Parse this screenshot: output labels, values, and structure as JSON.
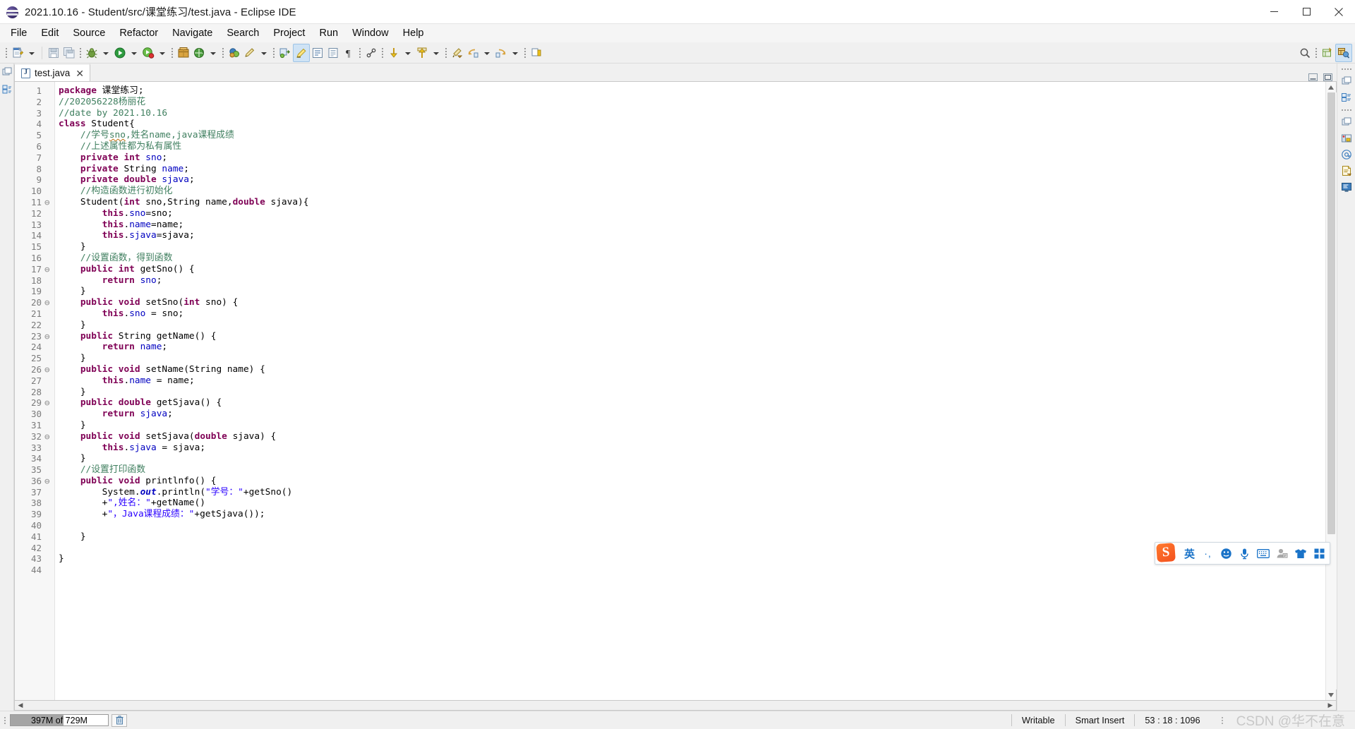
{
  "window": {
    "title": "2021.10.16 - Student/src/课堂练习/test.java - Eclipse IDE",
    "app_icon": "eclipse-sphere-icon",
    "minimize": "—",
    "maximize": "▢",
    "close": "✕"
  },
  "menubar": {
    "items": [
      {
        "label": "File"
      },
      {
        "label": "Edit"
      },
      {
        "label": "Source"
      },
      {
        "label": "Refactor"
      },
      {
        "label": "Navigate"
      },
      {
        "label": "Search"
      },
      {
        "label": "Project"
      },
      {
        "label": "Run"
      },
      {
        "label": "Window"
      },
      {
        "label": "Help"
      }
    ]
  },
  "toolbar": {
    "groups": [
      {
        "items": [
          {
            "name": "new-wizard",
            "icon": "new-file-icon",
            "dropdown": true
          }
        ]
      },
      {
        "items": [
          {
            "name": "save",
            "icon": "save-icon",
            "dropdown": false
          },
          {
            "name": "save-all",
            "icon": "save-all-icon",
            "dropdown": false
          }
        ]
      },
      {
        "items": [
          {
            "name": "debug",
            "icon": "debug-bug-icon",
            "dropdown": true
          },
          {
            "name": "run",
            "icon": "run-play-icon",
            "dropdown": true
          },
          {
            "name": "coverage",
            "icon": "coverage-icon",
            "dropdown": true
          }
        ]
      },
      {
        "items": [
          {
            "name": "new-java-package",
            "icon": "package-icon",
            "dropdown": false
          },
          {
            "name": "external-tools",
            "icon": "external-tools-icon",
            "dropdown": true
          }
        ]
      },
      {
        "items": [
          {
            "name": "new-java-class",
            "icon": "java-class-icon",
            "dropdown": false
          },
          {
            "name": "open-task",
            "icon": "pencil-icon",
            "dropdown": true
          }
        ]
      },
      {
        "items": [
          {
            "name": "search-refactor",
            "icon": "refactor-icon",
            "dropdown": false
          },
          {
            "name": "toggle-mark-occurrences",
            "icon": "marker-highlight-icon",
            "active": true
          },
          {
            "name": "show-whitespace",
            "icon": "whitespace-icon",
            "dropdown": false
          },
          {
            "name": "block-selection",
            "icon": "block-select-icon",
            "dropdown": false
          },
          {
            "name": "show-pilcrow",
            "icon": "pilcrow-icon",
            "dropdown": false
          }
        ]
      },
      {
        "items": [
          {
            "name": "link-editor",
            "icon": "link-icon",
            "dropdown": false
          }
        ]
      },
      {
        "items": [
          {
            "name": "previous-annotation",
            "icon": "arrow-down-yellow-icon",
            "dropdown": true
          },
          {
            "name": "next-annotation",
            "icon": "arrow-up-yellow-icon",
            "dropdown": true
          }
        ]
      },
      {
        "items": [
          {
            "name": "back",
            "icon": "back-arrow-icon",
            "dropdown": false
          },
          {
            "name": "forward",
            "icon": "forward-arrow-icon",
            "dropdown": false
          }
        ]
      },
      {
        "items": [
          {
            "name": "last-edit-location",
            "icon": "last-edit-icon",
            "dropdown": false
          },
          {
            "name": "back-history",
            "icon": "history-back-icon",
            "dropdown": true
          },
          {
            "name": "forward-history",
            "icon": "history-forward-icon",
            "dropdown": true
          }
        ]
      },
      {
        "items": [
          {
            "name": "pin-editor",
            "icon": "pin-icon",
            "dropdown": false
          }
        ]
      }
    ],
    "right": [
      {
        "name": "quick-access-search",
        "icon": "search-icon"
      },
      {
        "name": "open-perspective",
        "icon": "open-perspective-icon"
      },
      {
        "name": "java-perspective",
        "icon": "java-perspective-icon",
        "active": true
      }
    ]
  },
  "editor": {
    "tab": {
      "label": "test.java",
      "icon": "java-file-icon",
      "close": "✕",
      "active": true
    },
    "tab_controls": {
      "minimize": "minimize-icon",
      "maximize": "maximize-icon"
    },
    "lines": [
      {
        "n": 1,
        "fold": "",
        "tokens": [
          {
            "t": "package",
            "c": "kw"
          },
          {
            "t": " 课堂练习;",
            "c": "pl"
          }
        ]
      },
      {
        "n": 2,
        "fold": "",
        "tokens": [
          {
            "t": "//202056228杨丽花",
            "c": "cmt"
          }
        ]
      },
      {
        "n": 3,
        "fold": "",
        "tokens": [
          {
            "t": "//date by 2021.10.16",
            "c": "cmt"
          }
        ]
      },
      {
        "n": 4,
        "fold": "",
        "tokens": [
          {
            "t": "class",
            "c": "kw"
          },
          {
            "t": " Student{",
            "c": "pl"
          }
        ]
      },
      {
        "n": 5,
        "fold": "",
        "tokens": [
          {
            "t": "    //学号",
            "c": "cmt"
          },
          {
            "t": "sno",
            "c": "cmt sq"
          },
          {
            "t": ",姓名name,java课程成绩",
            "c": "cmt"
          }
        ]
      },
      {
        "n": 6,
        "fold": "",
        "tokens": [
          {
            "t": "    //上述属性都为私有属性",
            "c": "cmt"
          }
        ]
      },
      {
        "n": 7,
        "fold": "",
        "tokens": [
          {
            "t": "    ",
            "c": "pl"
          },
          {
            "t": "private int",
            "c": "kw"
          },
          {
            "t": " ",
            "c": "pl"
          },
          {
            "t": "sno",
            "c": "fld"
          },
          {
            "t": ";",
            "c": "pl"
          }
        ]
      },
      {
        "n": 8,
        "fold": "",
        "tokens": [
          {
            "t": "    ",
            "c": "pl"
          },
          {
            "t": "private",
            "c": "kw"
          },
          {
            "t": " String ",
            "c": "pl"
          },
          {
            "t": "name",
            "c": "fld"
          },
          {
            "t": ";",
            "c": "pl"
          }
        ]
      },
      {
        "n": 9,
        "fold": "",
        "tokens": [
          {
            "t": "    ",
            "c": "pl"
          },
          {
            "t": "private double",
            "c": "kw"
          },
          {
            "t": " ",
            "c": "pl"
          },
          {
            "t": "sjava",
            "c": "fld"
          },
          {
            "t": ";",
            "c": "pl"
          }
        ]
      },
      {
        "n": 10,
        "fold": "",
        "tokens": [
          {
            "t": "    //构造函数进行初始化",
            "c": "cmt"
          }
        ]
      },
      {
        "n": 11,
        "fold": "⊖",
        "tokens": [
          {
            "t": "    Student(",
            "c": "pl"
          },
          {
            "t": "int",
            "c": "kw"
          },
          {
            "t": " sno,String name,",
            "c": "pl"
          },
          {
            "t": "double",
            "c": "kw"
          },
          {
            "t": " sjava){",
            "c": "pl"
          }
        ]
      },
      {
        "n": 12,
        "fold": "",
        "tokens": [
          {
            "t": "        ",
            "c": "pl"
          },
          {
            "t": "this",
            "c": "kw"
          },
          {
            "t": ".",
            "c": "pl"
          },
          {
            "t": "sno",
            "c": "fld"
          },
          {
            "t": "=sno;",
            "c": "pl"
          }
        ]
      },
      {
        "n": 13,
        "fold": "",
        "tokens": [
          {
            "t": "        ",
            "c": "pl"
          },
          {
            "t": "this",
            "c": "kw"
          },
          {
            "t": ".",
            "c": "pl"
          },
          {
            "t": "name",
            "c": "fld"
          },
          {
            "t": "=name;",
            "c": "pl"
          }
        ]
      },
      {
        "n": 14,
        "fold": "",
        "tokens": [
          {
            "t": "        ",
            "c": "pl"
          },
          {
            "t": "this",
            "c": "kw"
          },
          {
            "t": ".",
            "c": "pl"
          },
          {
            "t": "sjava",
            "c": "fld"
          },
          {
            "t": "=sjava;",
            "c": "pl"
          }
        ]
      },
      {
        "n": 15,
        "fold": "",
        "tokens": [
          {
            "t": "    }",
            "c": "pl"
          }
        ]
      },
      {
        "n": 16,
        "fold": "",
        "tokens": [
          {
            "t": "    //设置函数，得到函数",
            "c": "cmt"
          }
        ]
      },
      {
        "n": 17,
        "fold": "⊖",
        "tokens": [
          {
            "t": "    ",
            "c": "pl"
          },
          {
            "t": "public int",
            "c": "kw"
          },
          {
            "t": " getSno() {",
            "c": "pl"
          }
        ]
      },
      {
        "n": 18,
        "fold": "",
        "tokens": [
          {
            "t": "        ",
            "c": "pl"
          },
          {
            "t": "return",
            "c": "kw"
          },
          {
            "t": " ",
            "c": "pl"
          },
          {
            "t": "sno",
            "c": "fld"
          },
          {
            "t": ";",
            "c": "pl"
          }
        ]
      },
      {
        "n": 19,
        "fold": "",
        "tokens": [
          {
            "t": "    }",
            "c": "pl"
          }
        ]
      },
      {
        "n": 20,
        "fold": "⊖",
        "tokens": [
          {
            "t": "    ",
            "c": "pl"
          },
          {
            "t": "public void",
            "c": "kw"
          },
          {
            "t": " setSno(",
            "c": "pl"
          },
          {
            "t": "int",
            "c": "kw"
          },
          {
            "t": " sno) {",
            "c": "pl"
          }
        ]
      },
      {
        "n": 21,
        "fold": "",
        "tokens": [
          {
            "t": "        ",
            "c": "pl"
          },
          {
            "t": "this",
            "c": "kw"
          },
          {
            "t": ".",
            "c": "pl"
          },
          {
            "t": "sno",
            "c": "fld"
          },
          {
            "t": " = sno;",
            "c": "pl"
          }
        ]
      },
      {
        "n": 22,
        "fold": "",
        "tokens": [
          {
            "t": "    }",
            "c": "pl"
          }
        ]
      },
      {
        "n": 23,
        "fold": "⊖",
        "tokens": [
          {
            "t": "    ",
            "c": "pl"
          },
          {
            "t": "public",
            "c": "kw"
          },
          {
            "t": " String getName() {",
            "c": "pl"
          }
        ]
      },
      {
        "n": 24,
        "fold": "",
        "tokens": [
          {
            "t": "        ",
            "c": "pl"
          },
          {
            "t": "return",
            "c": "kw"
          },
          {
            "t": " ",
            "c": "pl"
          },
          {
            "t": "name",
            "c": "fld"
          },
          {
            "t": ";",
            "c": "pl"
          }
        ]
      },
      {
        "n": 25,
        "fold": "",
        "tokens": [
          {
            "t": "    }",
            "c": "pl"
          }
        ]
      },
      {
        "n": 26,
        "fold": "⊖",
        "tokens": [
          {
            "t": "    ",
            "c": "pl"
          },
          {
            "t": "public void",
            "c": "kw"
          },
          {
            "t": " setName(String name) {",
            "c": "pl"
          }
        ]
      },
      {
        "n": 27,
        "fold": "",
        "tokens": [
          {
            "t": "        ",
            "c": "pl"
          },
          {
            "t": "this",
            "c": "kw"
          },
          {
            "t": ".",
            "c": "pl"
          },
          {
            "t": "name",
            "c": "fld"
          },
          {
            "t": " = name;",
            "c": "pl"
          }
        ]
      },
      {
        "n": 28,
        "fold": "",
        "tokens": [
          {
            "t": "    }",
            "c": "pl"
          }
        ]
      },
      {
        "n": 29,
        "fold": "⊖",
        "tokens": [
          {
            "t": "    ",
            "c": "pl"
          },
          {
            "t": "public double",
            "c": "kw"
          },
          {
            "t": " getSjava() {",
            "c": "pl"
          }
        ]
      },
      {
        "n": 30,
        "fold": "",
        "tokens": [
          {
            "t": "        ",
            "c": "pl"
          },
          {
            "t": "return",
            "c": "kw"
          },
          {
            "t": " ",
            "c": "pl"
          },
          {
            "t": "sjava",
            "c": "fld"
          },
          {
            "t": ";",
            "c": "pl"
          }
        ]
      },
      {
        "n": 31,
        "fold": "",
        "tokens": [
          {
            "t": "    }",
            "c": "pl"
          }
        ]
      },
      {
        "n": 32,
        "fold": "⊖",
        "tokens": [
          {
            "t": "    ",
            "c": "pl"
          },
          {
            "t": "public void",
            "c": "kw"
          },
          {
            "t": " setSjava(",
            "c": "pl"
          },
          {
            "t": "double",
            "c": "kw"
          },
          {
            "t": " sjava) {",
            "c": "pl"
          }
        ]
      },
      {
        "n": 33,
        "fold": "",
        "tokens": [
          {
            "t": "        ",
            "c": "pl"
          },
          {
            "t": "this",
            "c": "kw"
          },
          {
            "t": ".",
            "c": "pl"
          },
          {
            "t": "sjava",
            "c": "fld"
          },
          {
            "t": " = sjava;",
            "c": "pl"
          }
        ]
      },
      {
        "n": 34,
        "fold": "",
        "tokens": [
          {
            "t": "    }",
            "c": "pl"
          }
        ]
      },
      {
        "n": 35,
        "fold": "",
        "tokens": [
          {
            "t": "    //设置打印函数",
            "c": "cmt"
          }
        ]
      },
      {
        "n": 36,
        "fold": "⊖",
        "tokens": [
          {
            "t": "    ",
            "c": "pl"
          },
          {
            "t": "public void",
            "c": "kw"
          },
          {
            "t": " printlnfo() {",
            "c": "pl"
          }
        ]
      },
      {
        "n": 37,
        "fold": "",
        "tokens": [
          {
            "t": "        System.",
            "c": "pl"
          },
          {
            "t": "out",
            "c": "st"
          },
          {
            "t": ".println(",
            "c": "pl"
          },
          {
            "t": "\"学号：\"",
            "c": "str"
          },
          {
            "t": "+getSno()",
            "c": "pl"
          }
        ]
      },
      {
        "n": 38,
        "fold": "",
        "tokens": [
          {
            "t": "        +",
            "c": "pl"
          },
          {
            "t": "\",姓名：\"",
            "c": "str"
          },
          {
            "t": "+getName()",
            "c": "pl"
          }
        ]
      },
      {
        "n": 39,
        "fold": "",
        "tokens": [
          {
            "t": "        +",
            "c": "pl"
          },
          {
            "t": "\"，Java课程成绩：\"",
            "c": "str"
          },
          {
            "t": "+getSjava());",
            "c": "pl"
          }
        ]
      },
      {
        "n": 40,
        "fold": "",
        "tokens": [
          {
            "t": "",
            "c": "pl"
          }
        ]
      },
      {
        "n": 41,
        "fold": "",
        "tokens": [
          {
            "t": "    }",
            "c": "pl"
          }
        ]
      },
      {
        "n": 42,
        "fold": "",
        "tokens": [
          {
            "t": "",
            "c": "pl"
          }
        ]
      },
      {
        "n": 43,
        "fold": "",
        "tokens": [
          {
            "t": "}",
            "c": "pl"
          }
        ]
      },
      {
        "n": 44,
        "fold": "",
        "tokens": [
          {
            "t": "",
            "c": "pl"
          }
        ]
      }
    ]
  },
  "statusbar": {
    "heap": {
      "label": "397M of 729M",
      "used_mb": 397,
      "total_mb": 729,
      "percent": 54
    },
    "trash_icon": "trash-icon",
    "writable": "Writable",
    "insert_mode": "Smart Insert",
    "cursor_position": "53 : 18 : 1096",
    "watermark": "CSDN @华不在意"
  },
  "ime": {
    "logo": "sogou-logo-icon",
    "mode": "英",
    "punctuation": "·,",
    "items": [
      {
        "name": "emoji-icon"
      },
      {
        "name": "microphone-icon"
      },
      {
        "name": "soft-keyboard-icon"
      },
      {
        "name": "user-account-icon"
      },
      {
        "name": "skin-shirt-icon"
      },
      {
        "name": "app-grid-icon"
      }
    ]
  },
  "right_rail": {
    "items": [
      {
        "name": "restore-view-icon"
      },
      {
        "name": "package-explorer-icon"
      },
      {
        "name": "restore-view-2-icon"
      },
      {
        "name": "servers-icon"
      },
      {
        "name": "at-sign-icon"
      },
      {
        "name": "javadoc-icon"
      },
      {
        "name": "console-icon"
      }
    ]
  }
}
